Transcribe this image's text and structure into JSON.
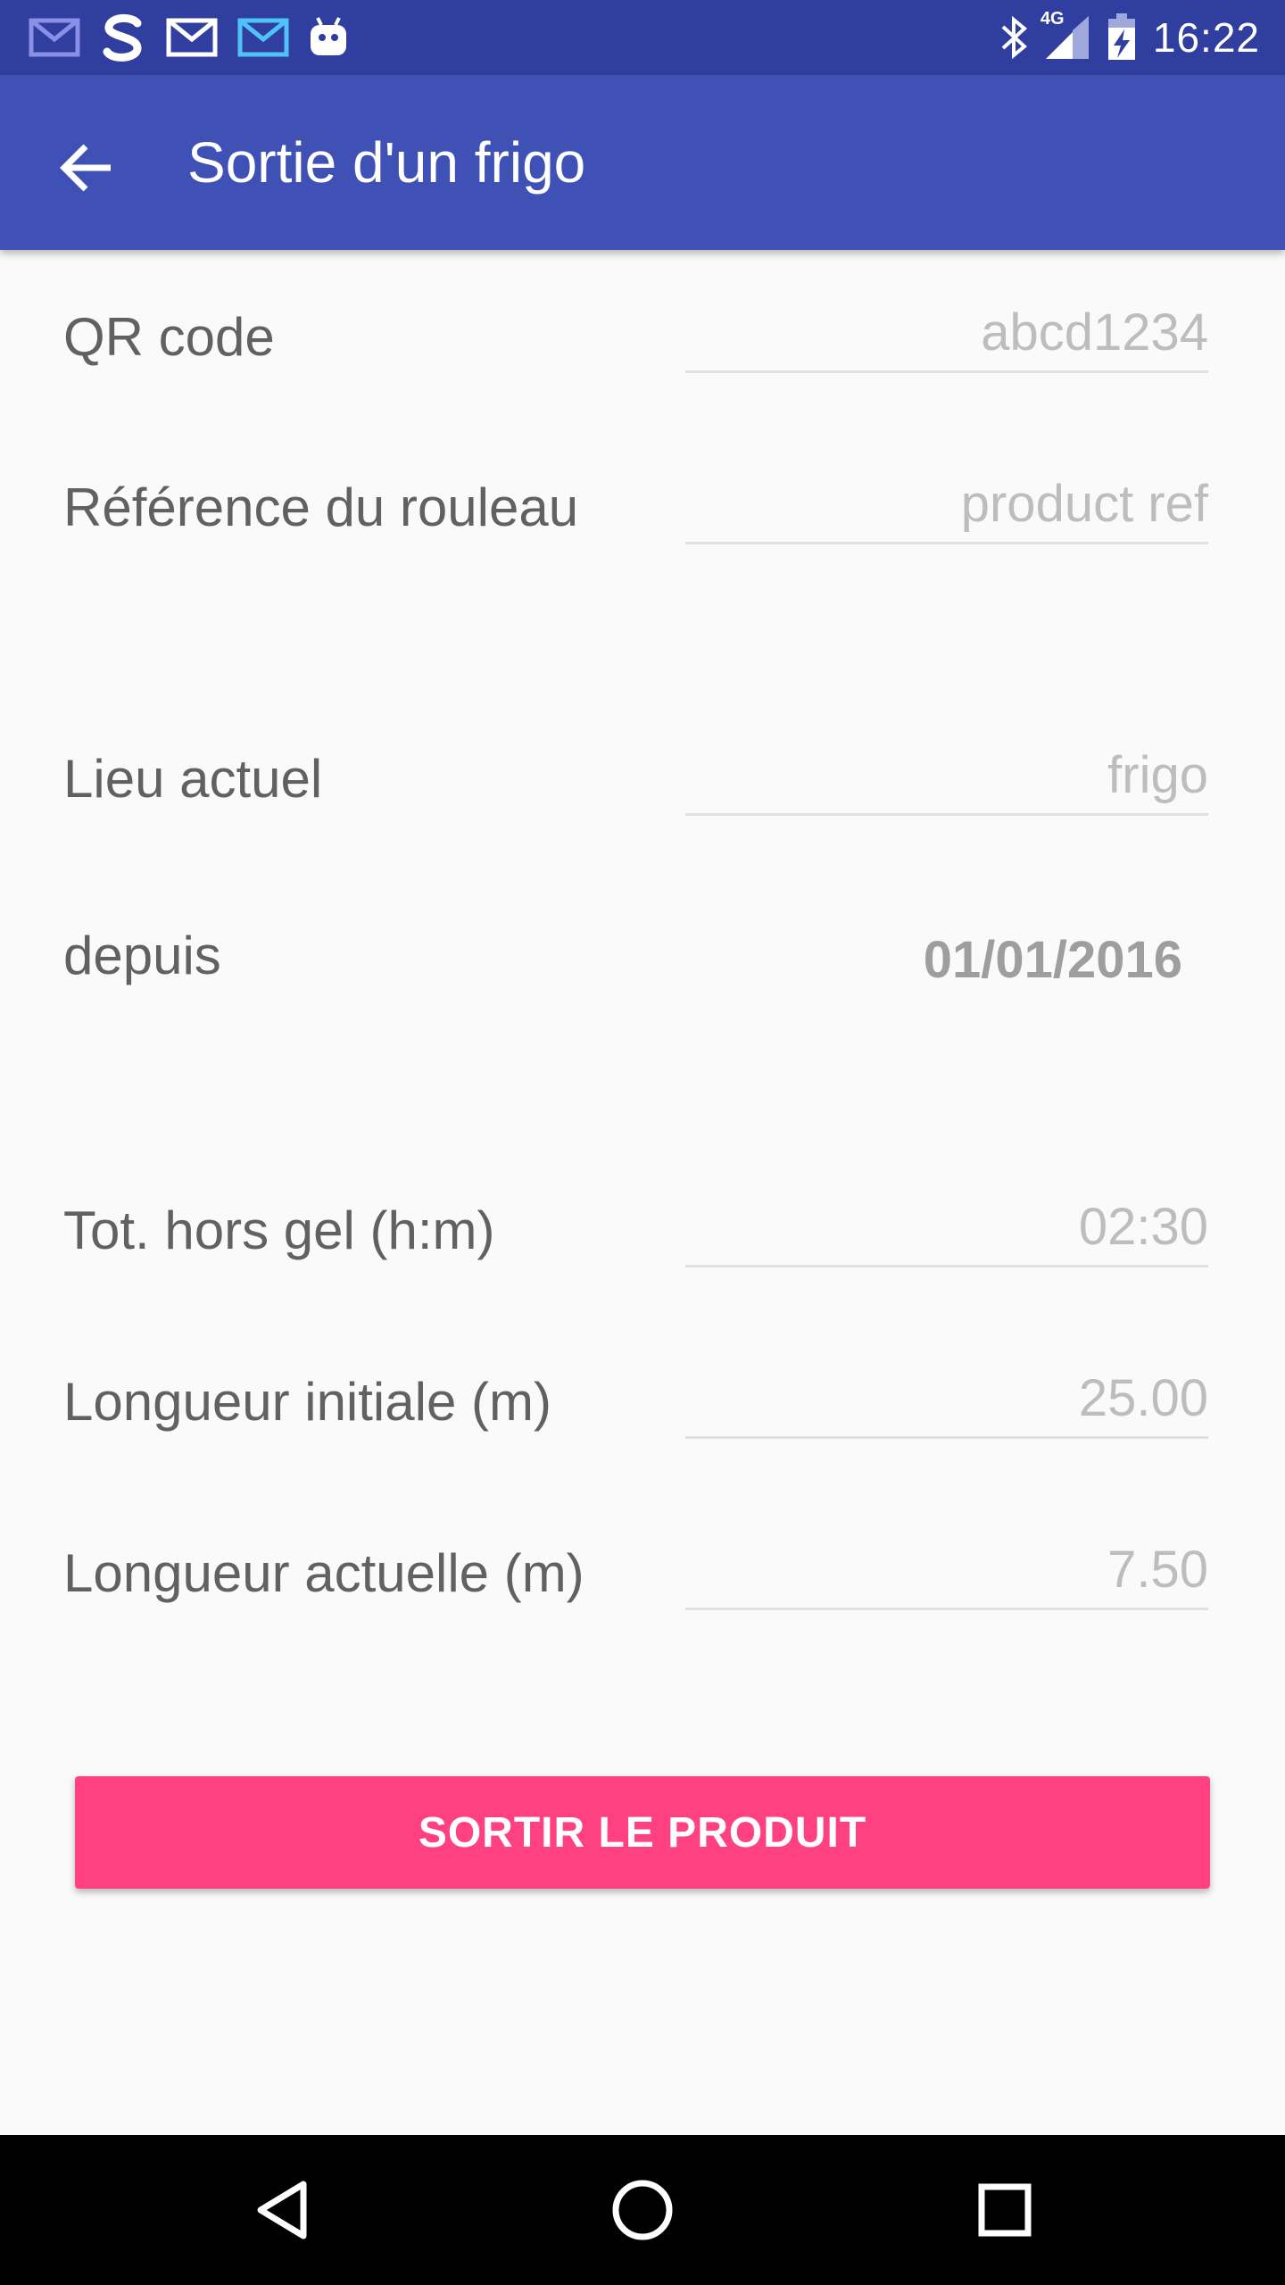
{
  "status_bar": {
    "time": "16:22",
    "network": "4G",
    "icons_left": [
      "mail-icon",
      "s-app-icon",
      "mail-icon",
      "mail-icon",
      "android-icon"
    ],
    "icons_right": [
      "bluetooth-icon",
      "signal-icon",
      "battery-charging-icon"
    ]
  },
  "app_bar": {
    "title": "Sortie d'un frigo",
    "back_icon": "arrow-back-icon"
  },
  "form": {
    "qr_code": {
      "label": "QR code",
      "value": "abcd1234"
    },
    "reference": {
      "label": "Référence du rouleau",
      "value": "product ref"
    },
    "lieu": {
      "label": "Lieu actuel",
      "value": "frigo"
    },
    "depuis": {
      "label": "depuis",
      "value": "01/01/2016"
    },
    "tot_hors_gel": {
      "label": "Tot. hors gel (h:m)",
      "value": "02:30"
    },
    "longueur_initiale": {
      "label": "Longueur initiale (m)",
      "value": "25.00"
    },
    "longueur_actuelle": {
      "label": "Longueur actuelle (m)",
      "value": "7.50"
    }
  },
  "actions": {
    "sortir_label": "SORTIR LE PRODUIT"
  },
  "nav_bar": {
    "back": "nav-back-icon",
    "home": "nav-home-icon",
    "recents": "nav-recents-icon"
  },
  "colors": {
    "status_bar": "#303f9f",
    "app_bar": "#3f51b5",
    "accent": "#ff4081",
    "background": "#fafafa"
  }
}
